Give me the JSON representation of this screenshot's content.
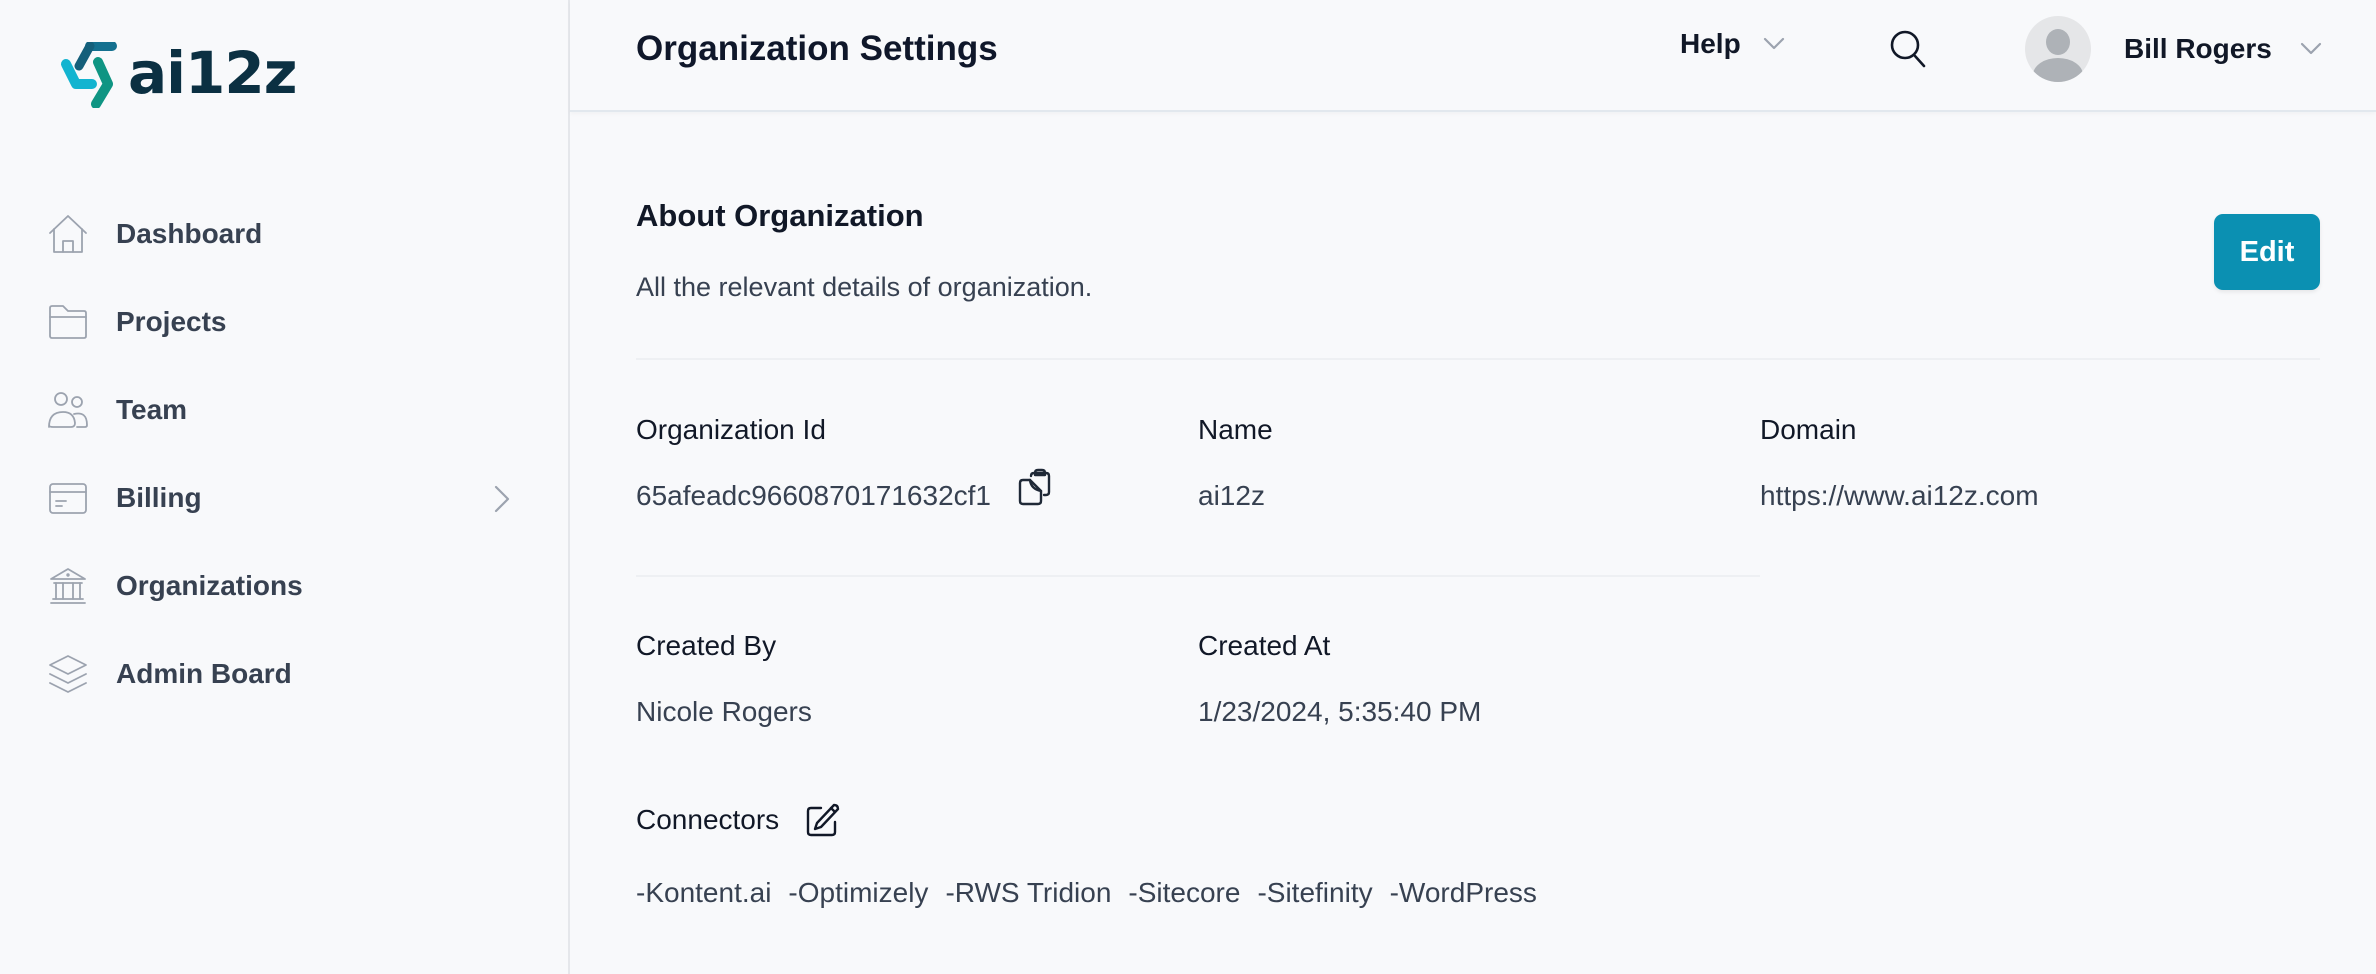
{
  "brand": {
    "name": "ai12z",
    "logo_colors": [
      "#13b4d0",
      "#14708f",
      "#0f9583"
    ],
    "wordmark_color": "#0b3042"
  },
  "sidebar": {
    "items": [
      {
        "label": "Dashboard",
        "icon": "home-icon",
        "has_chevron": false
      },
      {
        "label": "Projects",
        "icon": "folder-icon",
        "has_chevron": false
      },
      {
        "label": "Team",
        "icon": "users-icon",
        "has_chevron": false
      },
      {
        "label": "Billing",
        "icon": "credit-card-icon",
        "has_chevron": true
      },
      {
        "label": "Organizations",
        "icon": "bank-icon",
        "has_chevron": false
      },
      {
        "label": "Admin Board",
        "icon": "layers-icon",
        "has_chevron": false
      }
    ]
  },
  "header": {
    "title": "Organization Settings",
    "help_label": "Help",
    "search_icon": "search-icon",
    "user_name": "Bill Rogers"
  },
  "about": {
    "title": "About Organization",
    "description": "All the relevant details of organization.",
    "edit_label": "Edit",
    "accent_color": "#0b90b2"
  },
  "fields": {
    "org_id": {
      "label": "Organization Id",
      "value": "65afeadc9660870171632cf1"
    },
    "name": {
      "label": "Name",
      "value": "ai12z"
    },
    "domain": {
      "label": "Domain",
      "value": "https://www.ai12z.com"
    },
    "created_by": {
      "label": "Created By",
      "value": "Nicole Rogers"
    },
    "created_at": {
      "label": "Created At",
      "value": "1/23/2024, 5:35:40 PM"
    }
  },
  "connectors": {
    "label": "Connectors",
    "items": [
      "-Kontent.ai",
      "-Optimizely",
      "-RWS Tridion",
      "-Sitecore",
      "-Sitefinity",
      "-WordPress"
    ]
  }
}
